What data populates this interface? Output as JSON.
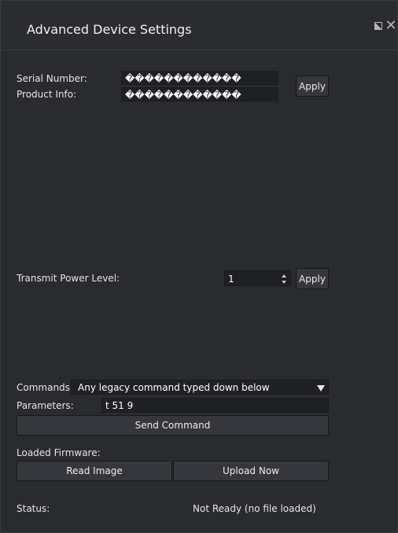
{
  "window": {
    "title": "Advanced Device Settings",
    "restore_icon": "restore-window-icon",
    "close_icon": "close-icon"
  },
  "device_info": {
    "serial_label": "Serial Number:",
    "serial_value": "������������",
    "product_label": "Product Info:",
    "product_value": "������������",
    "apply_label": "Apply"
  },
  "power": {
    "label": "Transmit Power Level:",
    "value": "1",
    "apply_label": "Apply"
  },
  "commands": {
    "label": "Commands:",
    "selected": "Any legacy command typed down below",
    "parameters_label": "Parameters:",
    "parameters_value": "t 51 9",
    "send_label": "Send Command"
  },
  "firmware": {
    "label": "Loaded Firmware:",
    "read_label": "Read Image",
    "upload_label": "Upload Now"
  },
  "status": {
    "label": "Status:",
    "value": "Not Ready (no file loaded)"
  }
}
